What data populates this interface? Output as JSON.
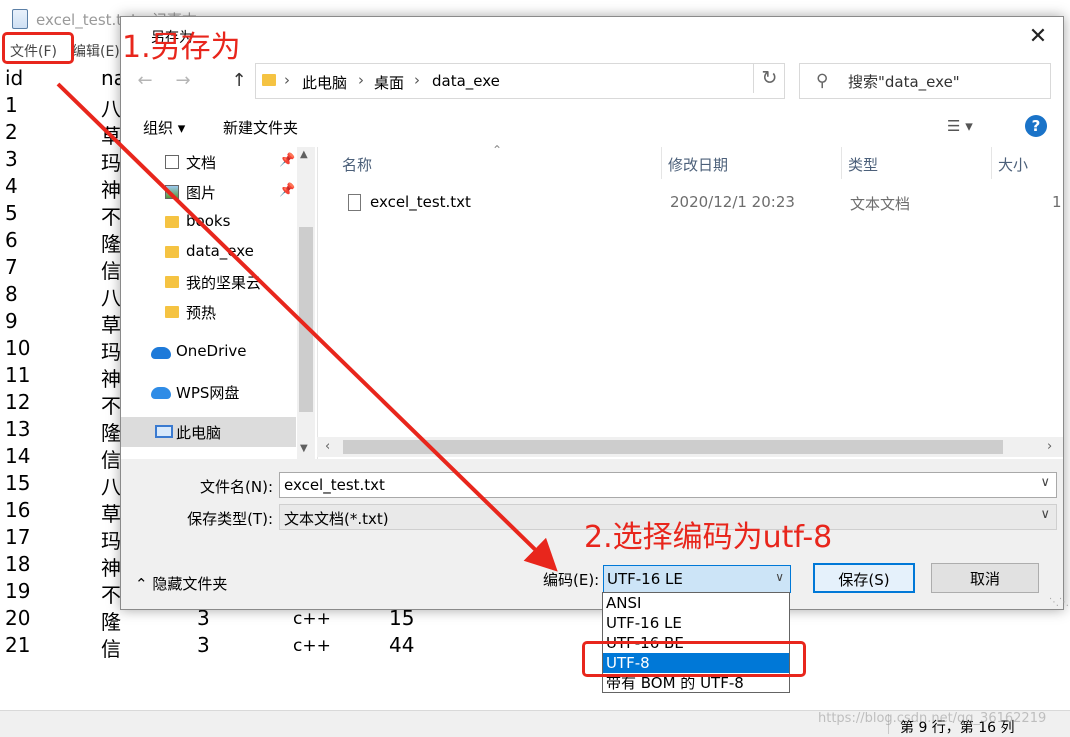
{
  "notepad": {
    "title": "excel_test.txt - 记事本",
    "menu": [
      "文件(F)",
      "编辑(E)"
    ],
    "header": [
      "id",
      "na"
    ],
    "rows": [
      [
        "1",
        "八"
      ],
      [
        "2",
        "草"
      ],
      [
        "3",
        "玛"
      ],
      [
        "4",
        "神"
      ],
      [
        "5",
        "不"
      ],
      [
        "6",
        "隆"
      ],
      [
        "7",
        "信"
      ],
      [
        "8",
        "八"
      ],
      [
        "9",
        "草"
      ],
      [
        "10",
        "玛"
      ],
      [
        "11",
        "神"
      ],
      [
        "12",
        "不"
      ],
      [
        "13",
        "隆"
      ],
      [
        "14",
        "信"
      ],
      [
        "15",
        "八"
      ],
      [
        "16",
        "草"
      ],
      [
        "17",
        "玛"
      ],
      [
        "18",
        "神"
      ],
      [
        "19",
        "不"
      ],
      [
        "20",
        "隆",
        "3",
        "c++",
        "15"
      ],
      [
        "21",
        "信",
        "3",
        "c++",
        "44"
      ]
    ],
    "status_position": "第 9 行，第 16 列",
    "watermark": "https://blog.csdn.net/qq_36162219"
  },
  "dialog": {
    "title": "另存为",
    "close": "✕",
    "back": "←",
    "forward": "→",
    "up": "↑",
    "breadcrumbs": [
      "此电脑",
      "桌面",
      "data_exe"
    ],
    "breadcrumb_sep": "›",
    "refresh": "↻",
    "search_placeholder": "搜索\"data_exe\"",
    "toolbar": {
      "organize": "组织 ▾",
      "new_folder": "新建文件夹",
      "help": "?"
    },
    "nav_items": [
      {
        "label": "文档",
        "icon": "document-icon",
        "pinned": true
      },
      {
        "label": "图片",
        "icon": "picture-icon",
        "pinned": true
      },
      {
        "label": "books",
        "icon": "folder-icon",
        "pinned": false
      },
      {
        "label": "data_exe",
        "icon": "folder-icon",
        "pinned": false
      },
      {
        "label": "我的坚果云",
        "icon": "folder-icon",
        "pinned": false
      },
      {
        "label": "预热",
        "icon": "folder-icon",
        "pinned": false
      },
      {
        "label": "OneDrive",
        "icon": "onedrive-icon",
        "pinned": false
      },
      {
        "label": "WPS网盘",
        "icon": "wps-cloud-icon",
        "pinned": false
      },
      {
        "label": "此电脑",
        "icon": "this-pc-icon",
        "pinned": false
      }
    ],
    "columns": [
      "名称",
      "修改日期",
      "类型",
      "大小"
    ],
    "files": [
      {
        "name": "excel_test.txt",
        "modified": "2020/12/1 20:23",
        "type": "文本文档",
        "size": "1"
      }
    ],
    "filename_label": "文件名(N):",
    "filename_value": "excel_test.txt",
    "filetype_label": "保存类型(T):",
    "filetype_value": "文本文档(*.txt)",
    "hide_folders": "隐藏文件夹",
    "encoding_label": "编码(E):",
    "encoding_value": "UTF-16 LE",
    "encoding_options": [
      "ANSI",
      "UTF-16 LE",
      "UTF-16 BE",
      "UTF-8",
      "带有 BOM 的 UTF-8"
    ],
    "encoding_highlighted": "UTF-8",
    "save_button": "保存(S)",
    "cancel_button": "取消"
  },
  "annotations": {
    "step1": "1.另存为",
    "step2": "2.选择编码为utf-8",
    "color": "#e8261c"
  }
}
